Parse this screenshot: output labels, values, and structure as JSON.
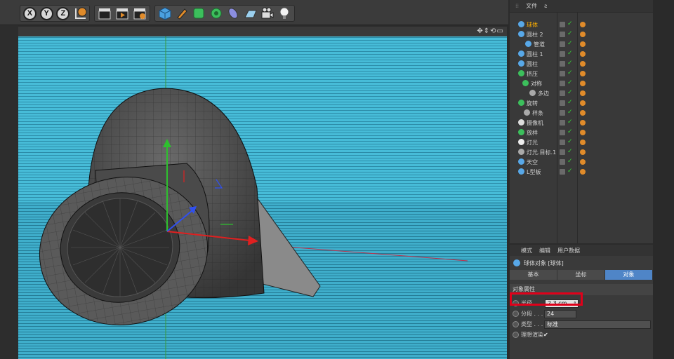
{
  "toolbar": {
    "axis_x": "X",
    "axis_y": "Y",
    "axis_z": "Z"
  },
  "object_manager": {
    "menu": {
      "file": "文件",
      "view_icon": "ƨ"
    },
    "items": [
      {
        "label": "球体",
        "active": true
      },
      {
        "label": "圆柱 2"
      },
      {
        "label": "管道"
      },
      {
        "label": "圆柱 1"
      },
      {
        "label": "圆柱"
      },
      {
        "label": "挤压"
      },
      {
        "label": "对称"
      },
      {
        "label": "多边"
      },
      {
        "label": "旋转"
      },
      {
        "label": "样条"
      },
      {
        "label": "摄像机"
      },
      {
        "label": "放样"
      },
      {
        "label": "灯光"
      },
      {
        "label": "灯光.目标.1"
      },
      {
        "label": "天空"
      },
      {
        "label": "L型板"
      }
    ]
  },
  "attributes": {
    "menu": {
      "mode": "模式",
      "edit": "编辑",
      "user_data": "用户数据"
    },
    "title": "球体对象 [球体]",
    "tabs": [
      {
        "label": "基本"
      },
      {
        "label": "坐标"
      },
      {
        "label": "对象",
        "selected": true
      }
    ],
    "section": "对象属性",
    "fields": {
      "radius_label": "半径 . . . .",
      "radius_value": "2.3 cm",
      "segments_label": "分段 . . . .",
      "segments_value": "24",
      "type_label": "类型 . . . .",
      "type_value": "标准",
      "render_label": "理想渲染",
      "render_check": "✔"
    }
  },
  "colors": {
    "viewport_bg": "#47bcd8",
    "active_label": "#ffb000",
    "selected_tab": "#4f85c7",
    "highlight_box": "#e0001a"
  }
}
